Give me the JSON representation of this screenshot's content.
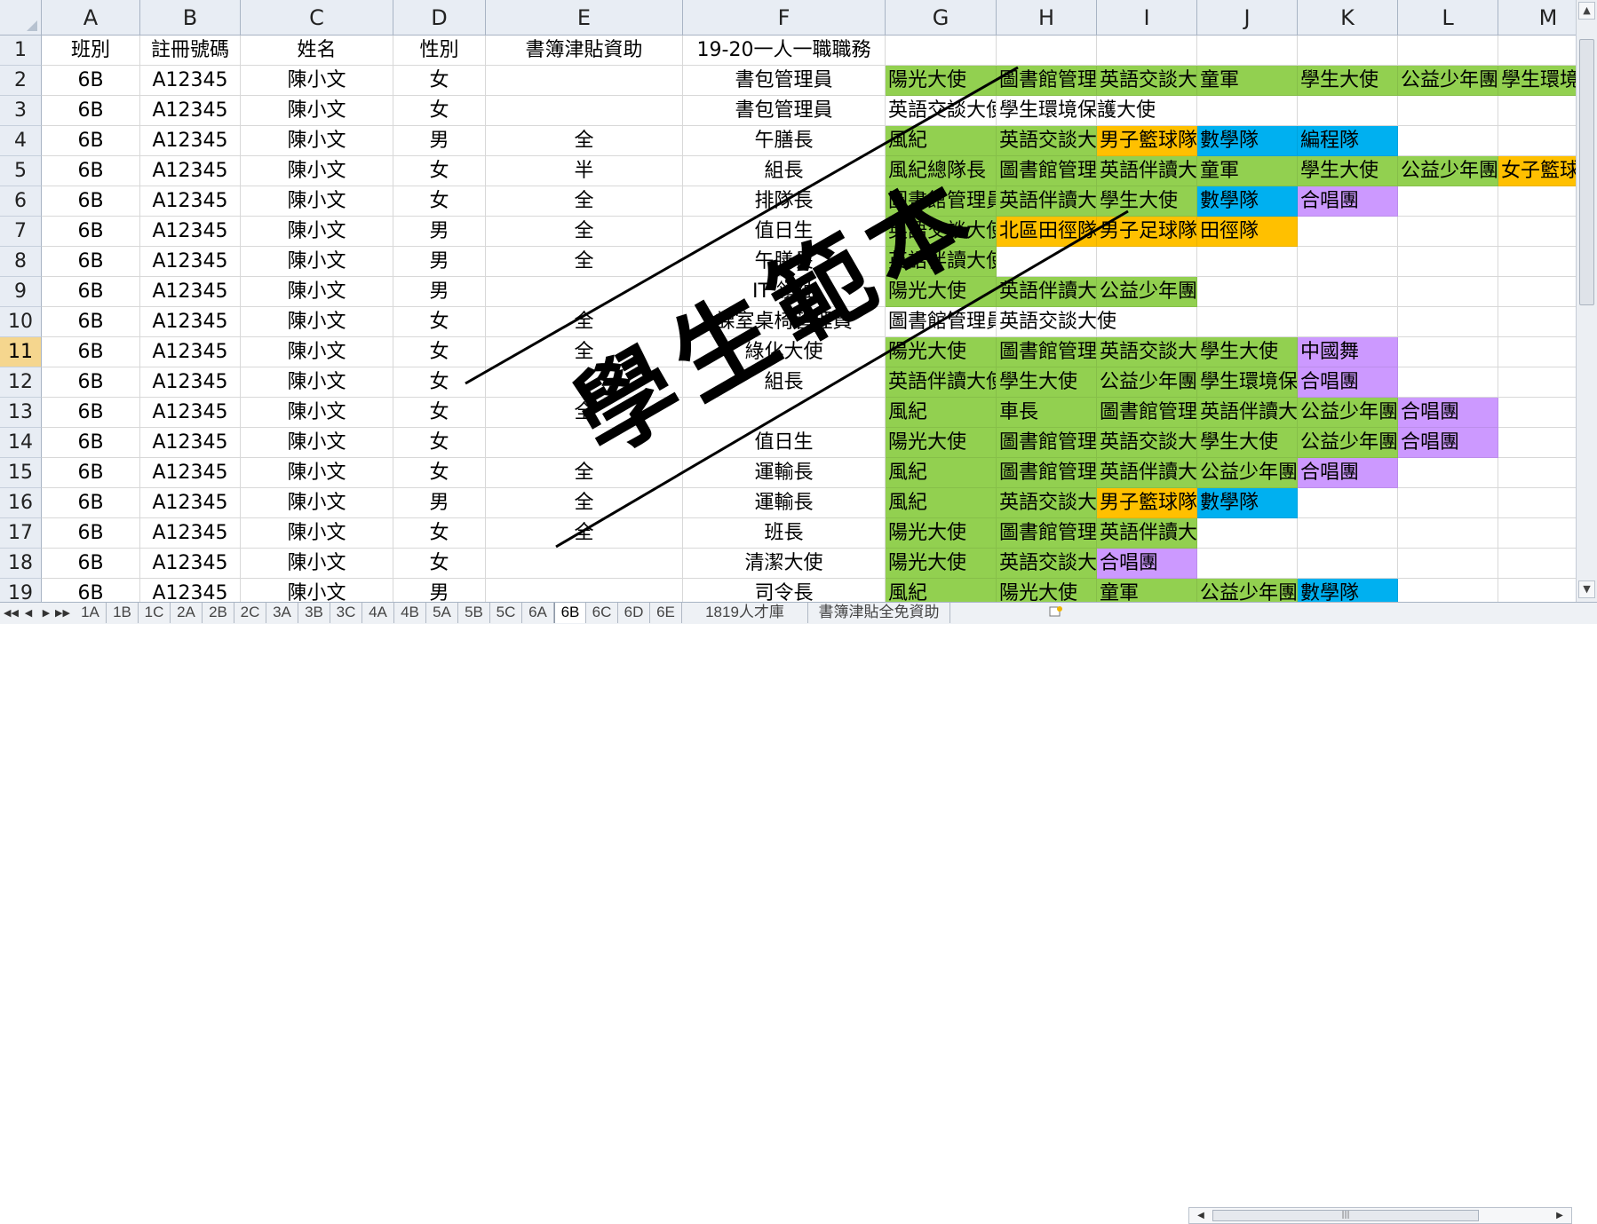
{
  "columns": [
    {
      "label": "A",
      "width": 111,
      "align": "c"
    },
    {
      "label": "B",
      "width": 113,
      "align": "c"
    },
    {
      "label": "C",
      "width": 172,
      "align": "c"
    },
    {
      "label": "D",
      "width": 104,
      "align": "c"
    },
    {
      "label": "E",
      "width": 222,
      "align": "c"
    },
    {
      "label": "F",
      "width": 228,
      "align": "c"
    },
    {
      "label": "G",
      "width": 125,
      "align": "l"
    },
    {
      "label": "H",
      "width": 113,
      "align": "l"
    },
    {
      "label": "I",
      "width": 113,
      "align": "l"
    },
    {
      "label": "J",
      "width": 113,
      "align": "l"
    },
    {
      "label": "K",
      "width": 113,
      "align": "l"
    },
    {
      "label": "L",
      "width": 113,
      "align": "l"
    },
    {
      "label": "M",
      "width": 113,
      "align": "l"
    }
  ],
  "selected_row": 11,
  "colors": {
    "G": "#92d050",
    "Y": "#ffc000",
    "B": "#00b0f0",
    "P": "#cc99ff"
  },
  "rows": [
    {
      "n": "1",
      "cells": [
        "班別",
        "註冊號碼",
        "姓名",
        "性別",
        "書簿津貼資助",
        "19-20一人一職職務",
        "",
        "",
        "",
        "",
        "",
        "",
        ""
      ],
      "fills": []
    },
    {
      "n": "2",
      "cells": [
        "6B",
        "A12345",
        "陳小文",
        "女",
        "",
        "書包管理員",
        "陽光大使",
        "圖書館管理員",
        "英語交談大使",
        "童軍",
        "學生大使",
        "公益少年團",
        "學生環境保護大使"
      ],
      "fills": [
        "",
        "",
        "",
        "",
        "",
        "",
        "G",
        "G",
        "G",
        "G",
        "G",
        "G",
        "G"
      ]
    },
    {
      "n": "3",
      "cells": [
        "6B",
        "A12345",
        "陳小文",
        "女",
        "",
        "書包管理員",
        "英語交談大使",
        "學生環境保護大使",
        "",
        "",
        "",
        "",
        ""
      ],
      "fills": [
        "",
        "",
        "",
        "",
        "",
        "",
        "",
        "",
        "",
        "",
        "",
        "",
        ""
      ]
    },
    {
      "n": "4",
      "cells": [
        "6B",
        "A12345",
        "陳小文",
        "男",
        "全",
        "午膳長",
        "風紀",
        "英語交談大使",
        "男子籃球隊",
        "數學隊",
        "編程隊",
        "",
        ""
      ],
      "fills": [
        "",
        "",
        "",
        "",
        "",
        "",
        "G",
        "G",
        "Y",
        "B",
        "B",
        "",
        ""
      ]
    },
    {
      "n": "5",
      "cells": [
        "6B",
        "A12345",
        "陳小文",
        "女",
        "半",
        "組長",
        "風紀總隊長",
        "圖書館管理員",
        "英語伴讀大使",
        "童軍",
        "學生大使",
        "公益少年團",
        "女子籃球隊"
      ],
      "fills": [
        "",
        "",
        "",
        "",
        "",
        "",
        "G",
        "G",
        "G",
        "G",
        "G",
        "G",
        "Y"
      ]
    },
    {
      "n": "6",
      "cells": [
        "6B",
        "A12345",
        "陳小文",
        "女",
        "全",
        "排隊長",
        "圖書館管理員",
        "英語伴讀大使",
        "學生大使",
        "數學隊",
        "合唱團",
        "",
        ""
      ],
      "fills": [
        "",
        "",
        "",
        "",
        "",
        "",
        "G",
        "G",
        "G",
        "B",
        "P",
        "",
        ""
      ]
    },
    {
      "n": "7",
      "cells": [
        "6B",
        "A12345",
        "陳小文",
        "男",
        "全",
        "值日生",
        "英語交談大使",
        "北區田徑隊",
        "男子足球隊",
        "田徑隊",
        "",
        "",
        ""
      ],
      "fills": [
        "",
        "",
        "",
        "",
        "",
        "",
        "G",
        "Y",
        "Y",
        "Y",
        "",
        "",
        ""
      ]
    },
    {
      "n": "8",
      "cells": [
        "6B",
        "A12345",
        "陳小文",
        "男",
        "全",
        "午膳長",
        "英語伴讀大使",
        "",
        "",
        "",
        "",
        "",
        ""
      ],
      "fills": [
        "",
        "",
        "",
        "",
        "",
        "",
        "G",
        "",
        "",
        "",
        "",
        "",
        ""
      ]
    },
    {
      "n": "9",
      "cells": [
        "6B",
        "A12345",
        "陳小文",
        "男",
        "",
        "IT 領袖",
        "陽光大使",
        "英語伴讀大使",
        "公益少年團",
        "",
        "",
        "",
        ""
      ],
      "fills": [
        "",
        "",
        "",
        "",
        "",
        "",
        "G",
        "G",
        "G",
        "",
        "",
        "",
        ""
      ]
    },
    {
      "n": "10",
      "cells": [
        "6B",
        "A12345",
        "陳小文",
        "女",
        "全",
        "課室桌椅管理員",
        "圖書館管理員",
        "英語交談大使",
        "",
        "",
        "",
        "",
        ""
      ],
      "fills": [
        "",
        "",
        "",
        "",
        "",
        "",
        "",
        "",
        "",
        "",
        "",
        "",
        ""
      ]
    },
    {
      "n": "11",
      "cells": [
        "6B",
        "A12345",
        "陳小文",
        "女",
        "全",
        "綠化大使",
        "陽光大使",
        "圖書館管理員",
        "英語交談大使",
        "學生大使",
        "中國舞",
        "",
        ""
      ],
      "fills": [
        "",
        "",
        "",
        "",
        "",
        "",
        "G",
        "G",
        "G",
        "G",
        "P",
        "",
        ""
      ]
    },
    {
      "n": "12",
      "cells": [
        "6B",
        "A12345",
        "陳小文",
        "女",
        "",
        "組長",
        "英語伴讀大使",
        "學生大使",
        "公益少年團",
        "學生環境保護大使",
        "合唱團",
        "",
        ""
      ],
      "fills": [
        "",
        "",
        "",
        "",
        "",
        "",
        "G",
        "G",
        "G",
        "G",
        "P",
        "",
        ""
      ]
    },
    {
      "n": "13",
      "cells": [
        "6B",
        "A12345",
        "陳小文",
        "女",
        "全",
        "",
        "風紀",
        "車長",
        "圖書館管理員",
        "英語伴讀大使",
        "公益少年團",
        "合唱團",
        ""
      ],
      "fills": [
        "",
        "",
        "",
        "",
        "",
        "",
        "G",
        "G",
        "G",
        "G",
        "G",
        "P",
        ""
      ]
    },
    {
      "n": "14",
      "cells": [
        "6B",
        "A12345",
        "陳小文",
        "女",
        "",
        "值日生",
        "陽光大使",
        "圖書館管理員",
        "英語交談大使",
        "學生大使",
        "公益少年團",
        "合唱團",
        ""
      ],
      "fills": [
        "",
        "",
        "",
        "",
        "",
        "",
        "G",
        "G",
        "G",
        "G",
        "G",
        "P",
        ""
      ]
    },
    {
      "n": "15",
      "cells": [
        "6B",
        "A12345",
        "陳小文",
        "女",
        "全",
        "運輸長",
        "風紀",
        "圖書館管理員",
        "英語伴讀大使",
        "公益少年團",
        "合唱團",
        "",
        ""
      ],
      "fills": [
        "",
        "",
        "",
        "",
        "",
        "",
        "G",
        "G",
        "G",
        "G",
        "P",
        "",
        ""
      ]
    },
    {
      "n": "16",
      "cells": [
        "6B",
        "A12345",
        "陳小文",
        "男",
        "全",
        "運輸長",
        "風紀",
        "英語交談大使",
        "男子籃球隊",
        "數學隊",
        "",
        "",
        ""
      ],
      "fills": [
        "",
        "",
        "",
        "",
        "",
        "",
        "G",
        "G",
        "Y",
        "B",
        "",
        "",
        ""
      ]
    },
    {
      "n": "17",
      "cells": [
        "6B",
        "A12345",
        "陳小文",
        "女",
        "全",
        "班長",
        "陽光大使",
        "圖書館管理員",
        "英語伴讀大使",
        "",
        "",
        "",
        ""
      ],
      "fills": [
        "",
        "",
        "",
        "",
        "",
        "",
        "G",
        "G",
        "G",
        "",
        "",
        "",
        ""
      ]
    },
    {
      "n": "18",
      "cells": [
        "6B",
        "A12345",
        "陳小文",
        "女",
        "",
        "清潔大使",
        "陽光大使",
        "英語交談大使",
        "合唱團",
        "",
        "",
        "",
        ""
      ],
      "fills": [
        "",
        "",
        "",
        "",
        "",
        "",
        "G",
        "G",
        "P",
        "",
        "",
        "",
        ""
      ]
    },
    {
      "n": "19",
      "cells": [
        "6B",
        "A12345",
        "陳小文",
        "男",
        "",
        "司令長",
        "風紀",
        "陽光大使",
        "童軍",
        "公益少年團",
        "數學隊",
        "",
        ""
      ],
      "fills": [
        "",
        "",
        "",
        "",
        "",
        "",
        "G",
        "G",
        "G",
        "G",
        "B",
        "",
        ""
      ]
    }
  ],
  "watermark": {
    "text": "學生範本"
  },
  "sheet_tabs": [
    "1A",
    "1B",
    "1C",
    "2A",
    "2B",
    "2C",
    "3A",
    "3B",
    "3C",
    "4A",
    "4B",
    "5A",
    "5B",
    "5C",
    "6A",
    "6B",
    "6C",
    "6D",
    "6E",
    "1819人才庫",
    "書簿津貼全免資助"
  ],
  "active_tab": "6B",
  "nav": {
    "first": "◀◀",
    "prev": "◀",
    "next": "▶",
    "last": "▶▶"
  },
  "scroll": {
    "up": "▲",
    "down": "▼",
    "left": "◀",
    "right": "▶",
    "grip": "|||"
  }
}
